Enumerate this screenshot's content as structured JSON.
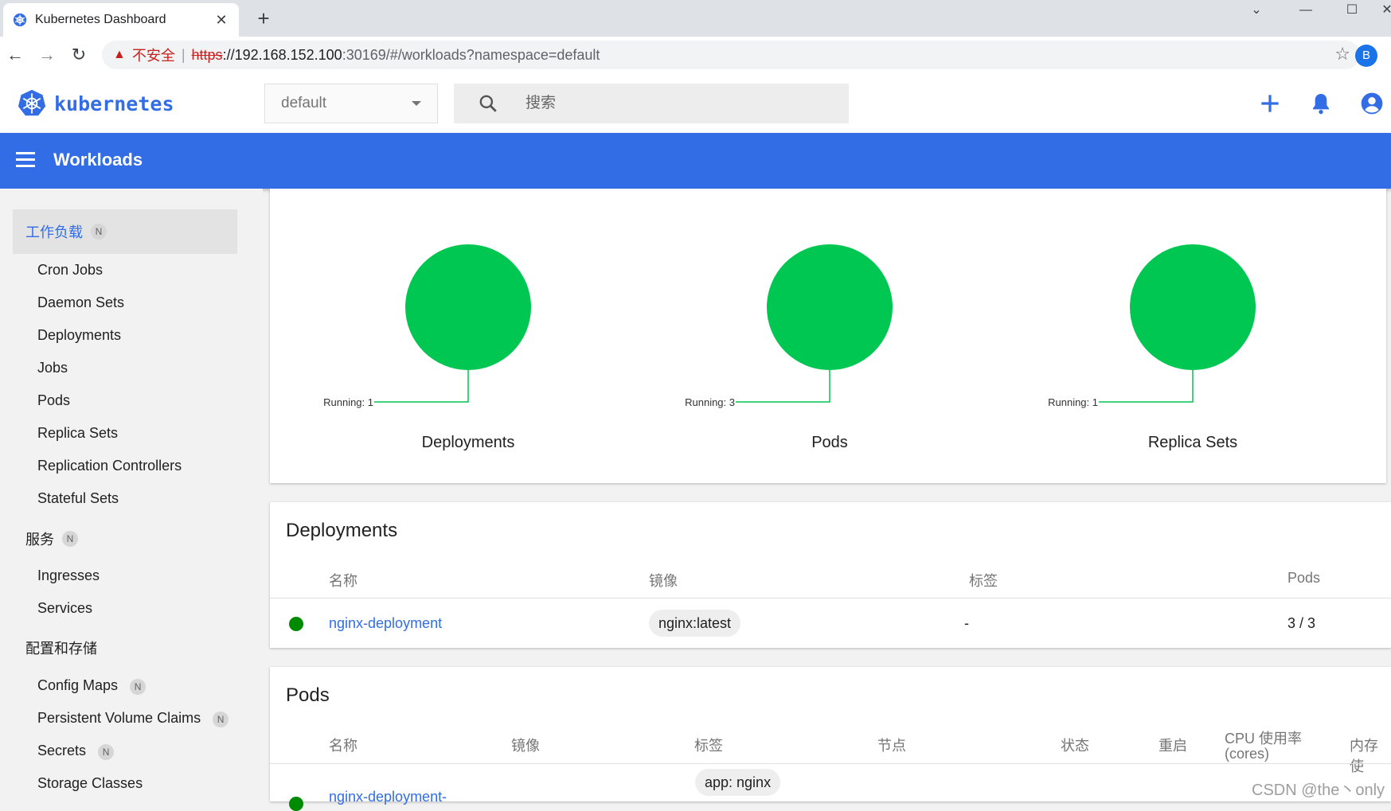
{
  "browser": {
    "tab_title": "Kubernetes Dashboard",
    "tab_close": "✕",
    "new_tab": "+",
    "security_label": "不安全",
    "url_scheme": "https",
    "url_host": "://192.168.152.100",
    "url_rest": ":30169/#/workloads?namespace=default",
    "profile_initial": "B"
  },
  "header": {
    "logo_text": "kubernetes",
    "namespace": "default",
    "search_placeholder": "搜索"
  },
  "toolbar": {
    "title": "Workloads"
  },
  "sidebar": {
    "group_workloads": {
      "label": "工作负载",
      "badge": "N"
    },
    "workload_items": [
      "Cron Jobs",
      "Daemon Sets",
      "Deployments",
      "Jobs",
      "Pods",
      "Replica Sets",
      "Replication Controllers",
      "Stateful Sets"
    ],
    "group_services": {
      "label": "服务",
      "badge": "N"
    },
    "service_items": [
      "Ingresses",
      "Services"
    ],
    "group_config": {
      "label": "配置和存储"
    },
    "config_items": [
      {
        "label": "Config Maps",
        "badge": "N"
      },
      {
        "label": "Persistent Volume Claims",
        "badge": "N"
      },
      {
        "label": "Secrets",
        "badge": "N"
      },
      {
        "label": "Storage Classes"
      }
    ]
  },
  "status": {
    "charts": [
      {
        "label": "Deployments",
        "running_label": "Running: 1",
        "running": 1
      },
      {
        "label": "Pods",
        "running_label": "Running: 3",
        "running": 3
      },
      {
        "label": "Replica Sets",
        "running_label": "Running: 1",
        "running": 1
      }
    ],
    "running_color": "#00c752"
  },
  "deployments": {
    "title": "Deployments",
    "columns": [
      "名称",
      "镜像",
      "标签",
      "Pods"
    ],
    "rows": [
      {
        "name": "nginx-deployment",
        "image": "nginx:latest",
        "labels": "-",
        "pods": "3 / 3"
      }
    ]
  },
  "pods": {
    "title": "Pods",
    "columns": [
      "名称",
      "镜像",
      "标签",
      "节点",
      "状态",
      "重启",
      "CPU 使用率",
      "(cores)",
      "内存使"
    ],
    "first_row": {
      "name": "nginx-deployment-",
      "label": "app: nginx"
    }
  },
  "watermark": "CSDN @the丶only",
  "colors": {
    "brand": "#326de6",
    "status_ok": "#008a00"
  }
}
